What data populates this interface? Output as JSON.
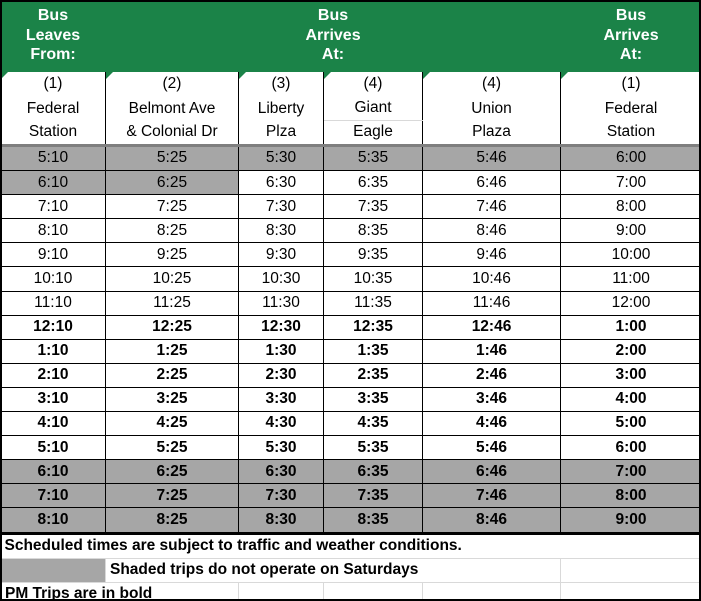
{
  "banner": {
    "left": "Bus\nLeaves\nFrom:",
    "left_l1": "Bus",
    "left_l2": "Leaves",
    "left_l3": "From:",
    "mid_l1": "Bus",
    "mid_l2": "Arrives",
    "mid_l3": "At:",
    "right_l1": "Bus",
    "right_l2": "Arrives",
    "right_l3": "At:"
  },
  "colors": {
    "header_green": "#1b8348",
    "shade_gray": "#a6a6a6",
    "text": "#000000",
    "grid": "#000000"
  },
  "columns": [
    {
      "number": "(1)",
      "name_l1": "Federal",
      "name_l2": "Station"
    },
    {
      "number": "(2)",
      "name_l1": "Belmont Ave",
      "name_l2": "& Colonial Dr"
    },
    {
      "number": "(3)",
      "name_l1": "Liberty",
      "name_l2": "Plza"
    },
    {
      "number": "(4)",
      "name_l1": "Giant",
      "name_l2": "Eagle"
    },
    {
      "number": "(4)",
      "name_l1": "Union",
      "name_l2": "Plaza"
    },
    {
      "number": "(1)",
      "name_l1": "Federal",
      "name_l2": "Station"
    }
  ],
  "rows": [
    {
      "times": [
        "5:10",
        "5:25",
        "5:30",
        "5:35",
        "5:46",
        "6:00"
      ],
      "pm": false,
      "shaded": [
        true,
        true,
        true,
        true,
        true,
        true
      ]
    },
    {
      "times": [
        "6:10",
        "6:25",
        "6:30",
        "6:35",
        "6:46",
        "7:00"
      ],
      "pm": false,
      "shaded": [
        true,
        true,
        false,
        false,
        false,
        false
      ]
    },
    {
      "times": [
        "7:10",
        "7:25",
        "7:30",
        "7:35",
        "7:46",
        "8:00"
      ],
      "pm": false,
      "shaded": [
        false,
        false,
        false,
        false,
        false,
        false
      ]
    },
    {
      "times": [
        "8:10",
        "8:25",
        "8:30",
        "8:35",
        "8:46",
        "9:00"
      ],
      "pm": false,
      "shaded": [
        false,
        false,
        false,
        false,
        false,
        false
      ]
    },
    {
      "times": [
        "9:10",
        "9:25",
        "9:30",
        "9:35",
        "9:46",
        "10:00"
      ],
      "pm": false,
      "shaded": [
        false,
        false,
        false,
        false,
        false,
        false
      ]
    },
    {
      "times": [
        "10:10",
        "10:25",
        "10:30",
        "10:35",
        "10:46",
        "11:00"
      ],
      "pm": false,
      "shaded": [
        false,
        false,
        false,
        false,
        false,
        false
      ]
    },
    {
      "times": [
        "11:10",
        "11:25",
        "11:30",
        "11:35",
        "11:46",
        "12:00"
      ],
      "pm": false,
      "shaded": [
        false,
        false,
        false,
        false,
        false,
        false
      ]
    },
    {
      "times": [
        "12:10",
        "12:25",
        "12:30",
        "12:35",
        "12:46",
        "1:00"
      ],
      "pm": true,
      "shaded": [
        false,
        false,
        false,
        false,
        false,
        false
      ]
    },
    {
      "times": [
        "1:10",
        "1:25",
        "1:30",
        "1:35",
        "1:46",
        "2:00"
      ],
      "pm": true,
      "shaded": [
        false,
        false,
        false,
        false,
        false,
        false
      ]
    },
    {
      "times": [
        "2:10",
        "2:25",
        "2:30",
        "2:35",
        "2:46",
        "3:00"
      ],
      "pm": true,
      "shaded": [
        false,
        false,
        false,
        false,
        false,
        false
      ]
    },
    {
      "times": [
        "3:10",
        "3:25",
        "3:30",
        "3:35",
        "3:46",
        "4:00"
      ],
      "pm": true,
      "shaded": [
        false,
        false,
        false,
        false,
        false,
        false
      ]
    },
    {
      "times": [
        "4:10",
        "4:25",
        "4:30",
        "4:35",
        "4:46",
        "5:00"
      ],
      "pm": true,
      "shaded": [
        false,
        false,
        false,
        false,
        false,
        false
      ]
    },
    {
      "times": [
        "5:10",
        "5:25",
        "5:30",
        "5:35",
        "5:46",
        "6:00"
      ],
      "pm": true,
      "shaded": [
        false,
        false,
        false,
        false,
        false,
        false
      ]
    },
    {
      "times": [
        "6:10",
        "6:25",
        "6:30",
        "6:35",
        "6:46",
        "7:00"
      ],
      "pm": true,
      "shaded": [
        true,
        true,
        true,
        true,
        true,
        true
      ]
    },
    {
      "times": [
        "7:10",
        "7:25",
        "7:30",
        "7:35",
        "7:46",
        "8:00"
      ],
      "pm": true,
      "shaded": [
        true,
        true,
        true,
        true,
        true,
        true
      ]
    },
    {
      "times": [
        "8:10",
        "8:25",
        "8:30",
        "8:35",
        "8:46",
        "9:00"
      ],
      "pm": true,
      "shaded": [
        true,
        true,
        true,
        true,
        true,
        true
      ]
    }
  ],
  "notes": {
    "note1": "Scheduled times are subject to traffic and weather conditions.",
    "note2": "Shaded trips do not operate on Saturdays",
    "note3": "PM Trips are in bold"
  }
}
